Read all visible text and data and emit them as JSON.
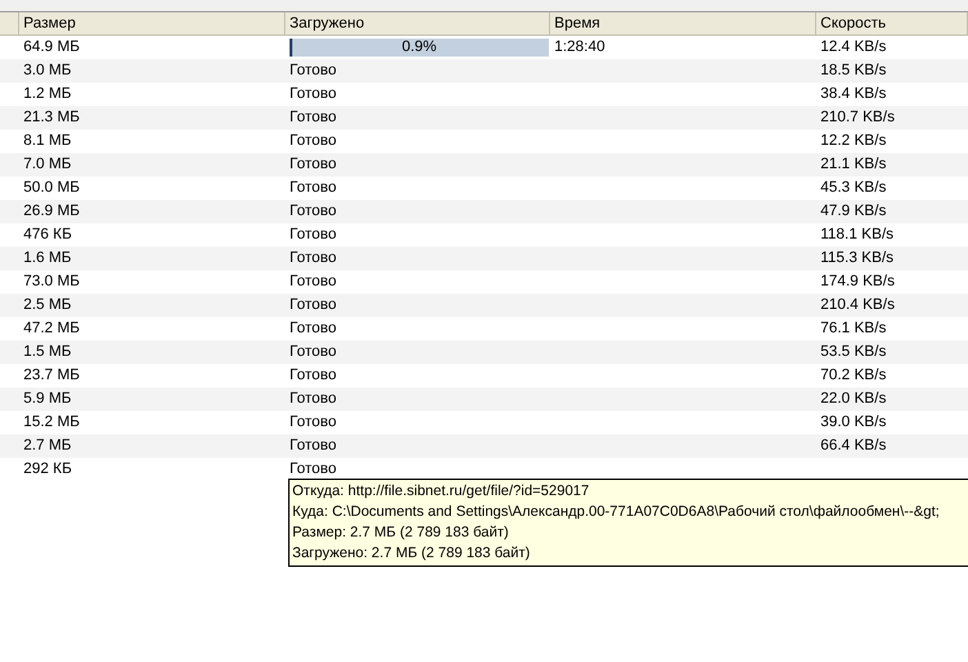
{
  "table": {
    "columns": [
      "Размер",
      "Загружено",
      "Время",
      "Скорость"
    ],
    "rows": [
      {
        "size": "64.9 МБ",
        "kind": "progress",
        "level": 0.009,
        "done": "0.9%",
        "time": "1:28:40",
        "speed": "12.4 KB/s"
      },
      {
        "size": "3.0 МБ",
        "kind": "text",
        "done": "Готово",
        "speed": "18.5 KB/s"
      },
      {
        "size": "1.2 МБ",
        "kind": "text",
        "done": "Готово",
        "speed": "38.4 KB/s"
      },
      {
        "size": "21.3 МБ",
        "kind": "text",
        "done": "Готово",
        "speed": "210.7 KB/s"
      },
      {
        "size": "8.1 МБ",
        "kind": "text",
        "done": "Готово",
        "speed": "12.2 KB/s"
      },
      {
        "size": "7.0 МБ",
        "kind": "text",
        "done": "Готово",
        "speed": "21.1 KB/s"
      },
      {
        "size": "50.0 МБ",
        "kind": "text",
        "done": "Готово",
        "speed": "45.3 KB/s"
      },
      {
        "size": "26.9 МБ",
        "kind": "text",
        "done": "Готово",
        "speed": "47.9 KB/s"
      },
      {
        "size": "476 КБ",
        "kind": "text",
        "done": "Готово",
        "speed": "118.1 KB/s"
      },
      {
        "size": "1.6 МБ",
        "kind": "text",
        "done": "Готово",
        "speed": "115.3 KB/s"
      },
      {
        "size": "73.0 МБ",
        "kind": "text",
        "done": "Готово",
        "speed": "174.9 KB/s"
      },
      {
        "size": "2.5 МБ",
        "kind": "text",
        "done": "Готово",
        "speed": "210.4 KB/s"
      },
      {
        "size": "47.2 МБ",
        "kind": "text",
        "done": "Готово",
        "speed": "76.1 KB/s"
      },
      {
        "size": "1.5 МБ",
        "kind": "text",
        "done": "Готово",
        "speed": "53.5 KB/s"
      },
      {
        "size": "23.7 МБ",
        "kind": "text",
        "done": "Готово",
        "speed": "70.2 KB/s"
      },
      {
        "size": "5.9 МБ",
        "kind": "text",
        "done": "Готово",
        "speed": "22.0 KB/s"
      },
      {
        "size": "15.2 МБ",
        "kind": "text",
        "done": "Готово",
        "speed": "39.0 KB/s"
      },
      {
        "size": "2.7 МБ",
        "kind": "text",
        "done": "Готово",
        "speed": "66.4 KB/s"
      },
      {
        "size": "292 КБ",
        "kind": "text",
        "done": "Готово"
      }
    ]
  },
  "tooltip": {
    "lines": [
      "Откуда: http://file.sibnet.ru/get/file/?id=529017",
      "Куда: C:\\Documents and Settings\\Александр.00-771A07C0D6A8\\Рабочий стол\\файлообмен\\--&gt;",
      "Размер: 2.7 МБ (2 789 183 байт)",
      "Загружено: 2.7 МБ (2 789 183 байт)"
    ]
  }
}
